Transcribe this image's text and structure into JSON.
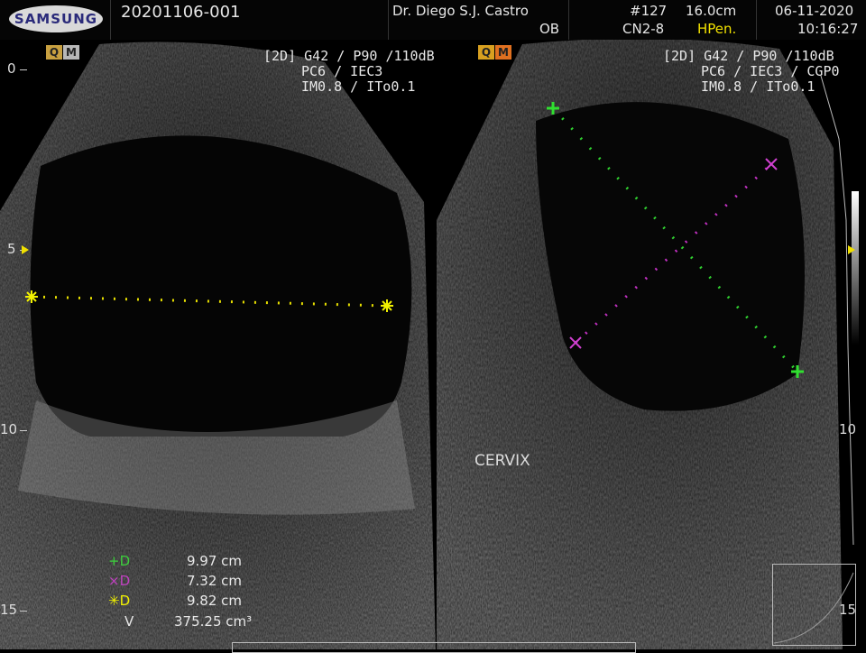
{
  "header": {
    "logo": "SAMSUNG",
    "patient_id": "20201106-001",
    "doctor": "Dr. Diego S.J. Castro",
    "exam": "OB",
    "image_number": "#127",
    "probe": "CN2-8",
    "depth": "16.0cm",
    "preset": "HPen.",
    "date": "06-11-2020",
    "time": "10:16:27"
  },
  "left_panel": {
    "badge_q": "Q",
    "badge_m": "M",
    "params": [
      "[2D] G42 / P90 /110dB",
      "PC6 / IEC3",
      "IM0.8 / ITo0.1"
    ]
  },
  "right_panel": {
    "badge_q": "Q",
    "badge_m": "M",
    "params": [
      "[2D] G42 / P90 /110dB",
      "PC6 / IEC3 / CGP0",
      "IM0.8 / ITo0.1"
    ],
    "label": "CERVIX"
  },
  "depth_scale": [
    "0",
    "5",
    "10",
    "15"
  ],
  "measurements": [
    {
      "marker": "+D",
      "value": "9.97 cm",
      "color": "#3ccf3c"
    },
    {
      "marker": "×D",
      "value": "7.32 cm",
      "color": "#c040c0"
    },
    {
      "marker": "✳D",
      "value": "9.82 cm",
      "color": "#f0f000"
    },
    {
      "marker": "V",
      "value": "375.25 cm³",
      "color": "#e8e8e8"
    }
  ]
}
